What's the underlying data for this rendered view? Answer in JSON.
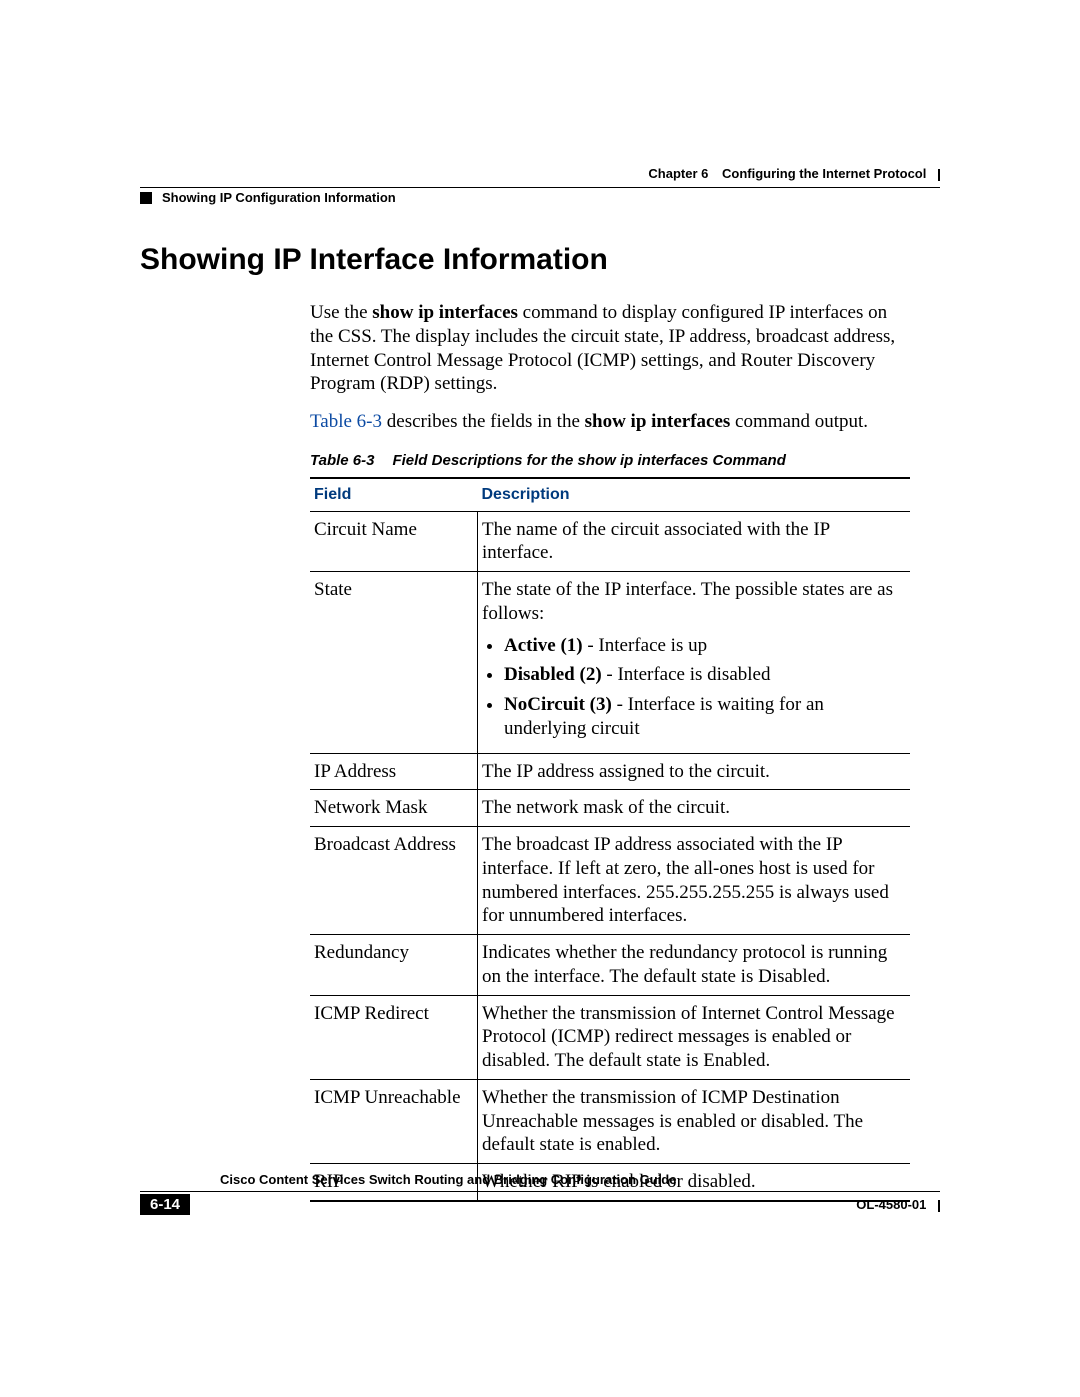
{
  "header": {
    "chapter_label": "Chapter 6",
    "chapter_title": "Configuring the Internet Protocol",
    "section_title": "Showing IP Configuration Information"
  },
  "main": {
    "heading": "Showing IP Interface Information",
    "para1_pre": "Use the ",
    "para1_cmd": "show ip interfaces",
    "para1_post": " command to display configured IP interfaces on the CSS. The display includes the circuit state, IP address, broadcast address, Internet Control Message Protocol (ICMP) settings, and Router Discovery Program (RDP) settings.",
    "para2_link": "Table 6-3",
    "para2_mid": " describes the fields in the ",
    "para2_cmd": "show ip interfaces",
    "para2_post": " command output.",
    "table_caption_num": "Table 6-3",
    "table_caption_text": "Field Descriptions for the show ip interfaces Command",
    "th_field": "Field",
    "th_desc": "Description",
    "rows": {
      "r0": {
        "field": "Circuit Name",
        "desc": "The name of the circuit associated with the IP interface."
      },
      "r1": {
        "field": "State",
        "intro": "The state of the IP interface. The possible states are as follows:",
        "b1_name": "Active (1)",
        "b1_rest": " - Interface is up",
        "b2_name": "Disabled (2)",
        "b2_rest": " - Interface is disabled",
        "b3_name": "NoCircuit (3)",
        "b3_rest": " - Interface is waiting for an underlying circuit"
      },
      "r2": {
        "field": "IP Address",
        "desc": "The IP address assigned to the circuit."
      },
      "r3": {
        "field": "Network Mask",
        "desc": "The network mask of the circuit."
      },
      "r4": {
        "field": "Broadcast Address",
        "desc": "The broadcast IP address associated with the IP interface. If left at zero, the all-ones host is used for numbered interfaces. 255.255.255.255 is always used for unnumbered interfaces."
      },
      "r5": {
        "field": "Redundancy",
        "desc": "Indicates whether the redundancy protocol is running on the interface. The default state is Disabled."
      },
      "r6": {
        "field": "ICMP Redirect",
        "desc": "Whether the transmission of Internet Control Message Protocol (ICMP) redirect messages is enabled or disabled. The default state is Enabled."
      },
      "r7": {
        "field": "ICMP Unreachable",
        "desc": "Whether the transmission of ICMP Destination Unreachable messages is enabled or disabled. The default state is enabled."
      },
      "r8": {
        "field": "RIP",
        "desc": "Whether RIP is enabled or disabled."
      }
    }
  },
  "footer": {
    "book_title": "Cisco Content Services Switch Routing and Bridging Configuration Guide",
    "page_num": "6-14",
    "doc_id": "OL-4580-01"
  }
}
